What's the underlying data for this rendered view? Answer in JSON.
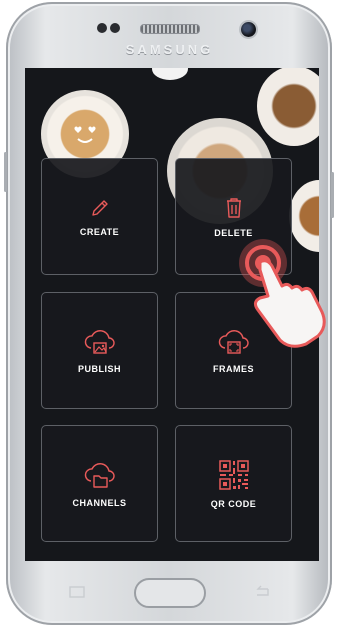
{
  "device": {
    "brand": "SAMSUNG"
  },
  "menu": {
    "tiles": [
      {
        "label": "CREATE",
        "icon": "pencil-icon"
      },
      {
        "label": "DELETE",
        "icon": "trash-icon"
      },
      {
        "label": "PUBLISH",
        "icon": "cloud-image-icon"
      },
      {
        "label": "FRAMES",
        "icon": "cloud-frame-icon"
      },
      {
        "label": "CHANNELS",
        "icon": "cloud-folder-icon"
      },
      {
        "label": "QR CODE",
        "icon": "qr-code-icon"
      }
    ]
  },
  "colors": {
    "accent": "#e85a5a",
    "tile_background": "#18191d",
    "tile_border": "#5d6066",
    "screen_background": "#15171b"
  }
}
